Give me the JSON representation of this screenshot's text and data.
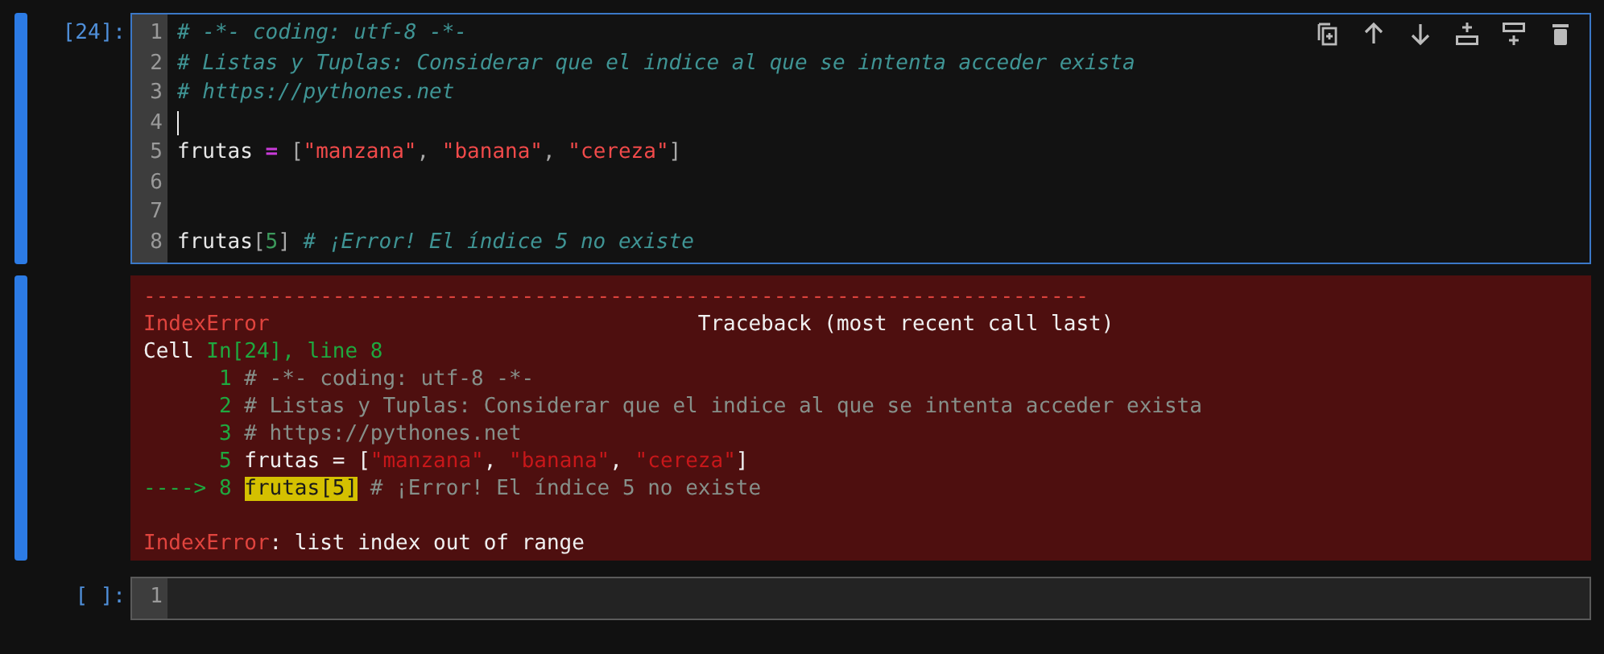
{
  "cells": [
    {
      "prompt": "[24]:",
      "selected": true,
      "toolbar": [
        {
          "kind": "duplicate"
        },
        {
          "kind": "up"
        },
        {
          "kind": "down"
        },
        {
          "kind": "insert-above"
        },
        {
          "kind": "insert-below"
        },
        {
          "kind": "delete"
        }
      ],
      "lines": [
        {
          "number": "1",
          "cursor": false,
          "tokens": [
            {
              "kind": "comment",
              "text": "# -*- coding: utf-8 -*-"
            }
          ]
        },
        {
          "number": "2",
          "cursor": false,
          "tokens": [
            {
              "kind": "comment",
              "text": "# Listas y Tuplas: Considerar que el indice al que se intenta acceder exista"
            }
          ]
        },
        {
          "number": "3",
          "cursor": false,
          "tokens": [
            {
              "kind": "comment",
              "text": "# https://pythones.net"
            }
          ]
        },
        {
          "number": "4",
          "cursor": true
        },
        {
          "number": "5",
          "cursor": false,
          "tokens": [
            {
              "kind": "name",
              "text": "frutas "
            },
            {
              "kind": "op",
              "text": "="
            },
            {
              "kind": "punct",
              "text": " ["
            },
            {
              "kind": "string",
              "text": "\"manzana\""
            },
            {
              "kind": "punct",
              "text": ", "
            },
            {
              "kind": "string",
              "text": "\"banana\""
            },
            {
              "kind": "punct",
              "text": ", "
            },
            {
              "kind": "string",
              "text": "\"cereza\""
            },
            {
              "kind": "punct",
              "text": "]"
            }
          ]
        },
        {
          "number": "6",
          "cursor": false
        },
        {
          "number": "7",
          "cursor": false
        },
        {
          "number": "8",
          "cursor": false,
          "tokens": [
            {
              "kind": "name",
              "text": "frutas"
            },
            {
              "kind": "punct",
              "text": "["
            },
            {
              "kind": "number",
              "text": "5"
            },
            {
              "kind": "punct",
              "text": "]"
            },
            {
              "kind": "comment",
              "text": " # ¡Error! El índice 5 no existe"
            }
          ]
        }
      ],
      "output": {
        "kind": "error",
        "lines": [
          {
            "tokens": [
              {
                "kind": "red",
                "text": "---------------------------------------------------------------------------"
              }
            ]
          },
          {
            "tokens": [
              {
                "kind": "red",
                "text": "IndexError"
              },
              {
                "kind": "plain",
                "text": "                                  Traceback (most recent call last)"
              }
            ]
          },
          {
            "tokens": [
              {
                "kind": "plain",
                "text": "Cell "
              },
              {
                "kind": "green",
                "text": "In[24], line 8"
              }
            ]
          },
          {
            "tokens": [
              {
                "kind": "green",
                "text": "      1 "
              },
              {
                "kind": "comment",
                "text": "# -*- coding: utf-8 -*-"
              }
            ]
          },
          {
            "tokens": [
              {
                "kind": "green",
                "text": "      2 "
              },
              {
                "kind": "comment",
                "text": "# Listas y Tuplas: Considerar que el indice al que se intenta acceder exista"
              }
            ]
          },
          {
            "tokens": [
              {
                "kind": "green",
                "text": "      3 "
              },
              {
                "kind": "comment",
                "text": "# https://pythones.net"
              }
            ]
          },
          {
            "tokens": [
              {
                "kind": "green",
                "text": "      5 "
              },
              {
                "kind": "plain",
                "text": "frutas = ["
              },
              {
                "kind": "string",
                "text": "\"manzana\""
              },
              {
                "kind": "plain",
                "text": ", "
              },
              {
                "kind": "string",
                "text": "\"banana\""
              },
              {
                "kind": "plain",
                "text": ", "
              },
              {
                "kind": "string",
                "text": "\"cereza\""
              },
              {
                "kind": "plain",
                "text": "]"
              }
            ]
          },
          {
            "tokens": [
              {
                "kind": "green",
                "text": "----> 8 "
              },
              {
                "kind": "highlight",
                "text": "frutas[5]"
              },
              {
                "kind": "comment",
                "text": " # ¡Error! El índice 5 no existe"
              }
            ]
          },
          {
            "tokens": [
              {
                "kind": "red",
                "text": "IndexError"
              },
              {
                "kind": "plain",
                "text": ": list index out of range"
              }
            ]
          }
        ]
      }
    },
    {
      "prompt": "[ ]:",
      "selected": false,
      "lines": [
        {
          "number": "1",
          "cursor": false
        }
      ]
    }
  ]
}
